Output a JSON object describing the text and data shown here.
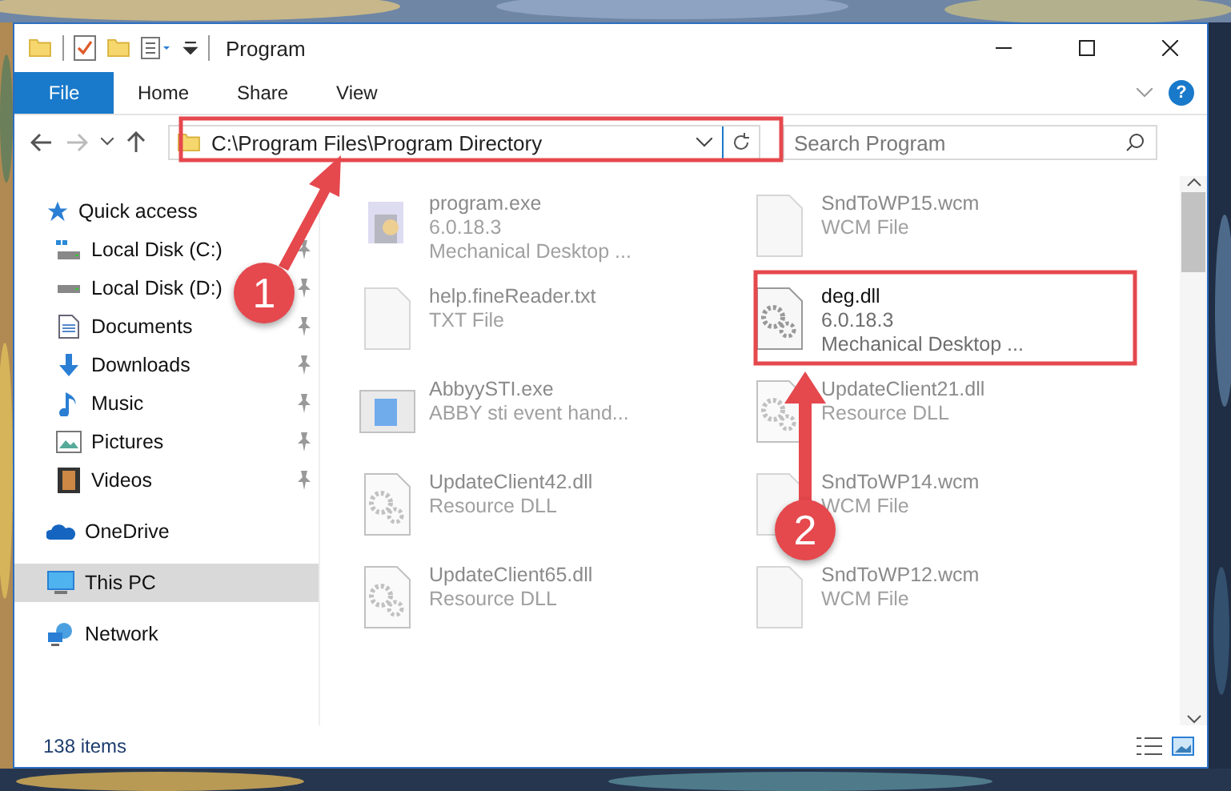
{
  "window": {
    "title": "Program"
  },
  "ribbon": {
    "tabs": [
      {
        "label": "File",
        "selected": true
      },
      {
        "label": "Home",
        "selected": false
      },
      {
        "label": "Share",
        "selected": false
      },
      {
        "label": "View",
        "selected": false
      }
    ],
    "help": "?"
  },
  "address_bar": {
    "path": "C:\\Program Files\\Program Directory",
    "highlighted": true
  },
  "search": {
    "placeholder": "Search Program"
  },
  "sidebar": {
    "items": [
      {
        "label": "Quick access",
        "selected": false,
        "children": [
          {
            "label": "Local Disk (C:)",
            "pinned": true
          },
          {
            "label": "Local Disk (D:)",
            "pinned": true
          },
          {
            "label": "Documents",
            "pinned": true
          },
          {
            "label": "Downloads",
            "pinned": true
          },
          {
            "label": "Music",
            "pinned": true
          },
          {
            "label": "Pictures",
            "pinned": true
          },
          {
            "label": "Videos",
            "pinned": true
          }
        ]
      },
      {
        "label": "OneDrive",
        "selected": false
      },
      {
        "label": "This PC",
        "selected": true
      },
      {
        "label": "Network",
        "selected": false
      }
    ]
  },
  "files": [
    {
      "kind": "exe",
      "name": "program.exe",
      "details": [
        "6.0.18.3",
        "Mechanical Desktop ..."
      ],
      "blurred": true,
      "highlighted": false
    },
    {
      "kind": "doc",
      "name": "SndToWP15.wcm",
      "details": [
        "WCM File"
      ],
      "blurred": true,
      "highlighted": false
    },
    {
      "kind": "doc",
      "name": "help.fineReader.txt",
      "details": [
        "TXT File"
      ],
      "blurred": true,
      "highlighted": false
    },
    {
      "kind": "dll",
      "name": "deg.dll",
      "details": [
        "6.0.18.3",
        "Mechanical Desktop ..."
      ],
      "blurred": false,
      "highlighted": true
    },
    {
      "kind": "app",
      "name": "AbbyySTI.exe",
      "details": [
        "ABBY sti event hand..."
      ],
      "blurred": true,
      "highlighted": false
    },
    {
      "kind": "dll",
      "name": "UpdateClient21.dll",
      "details": [
        "Resource DLL"
      ],
      "blurred": true,
      "highlighted": false
    },
    {
      "kind": "dll",
      "name": "UpdateClient42.dll",
      "details": [
        "Resource DLL"
      ],
      "blurred": true,
      "highlighted": false
    },
    {
      "kind": "doc",
      "name": "SndToWP14.wcm",
      "details": [
        "WCM File"
      ],
      "blurred": true,
      "highlighted": false
    },
    {
      "kind": "dll",
      "name": "UpdateClient65.dll",
      "details": [
        "Resource DLL"
      ],
      "blurred": true,
      "highlighted": false
    },
    {
      "kind": "doc",
      "name": "SndToWP12.wcm",
      "details": [
        "WCM File"
      ],
      "blurred": true,
      "highlighted": false
    }
  ],
  "status_bar": {
    "count": "138 items"
  },
  "annotations": [
    {
      "label": "1"
    },
    {
      "label": "2"
    }
  ]
}
